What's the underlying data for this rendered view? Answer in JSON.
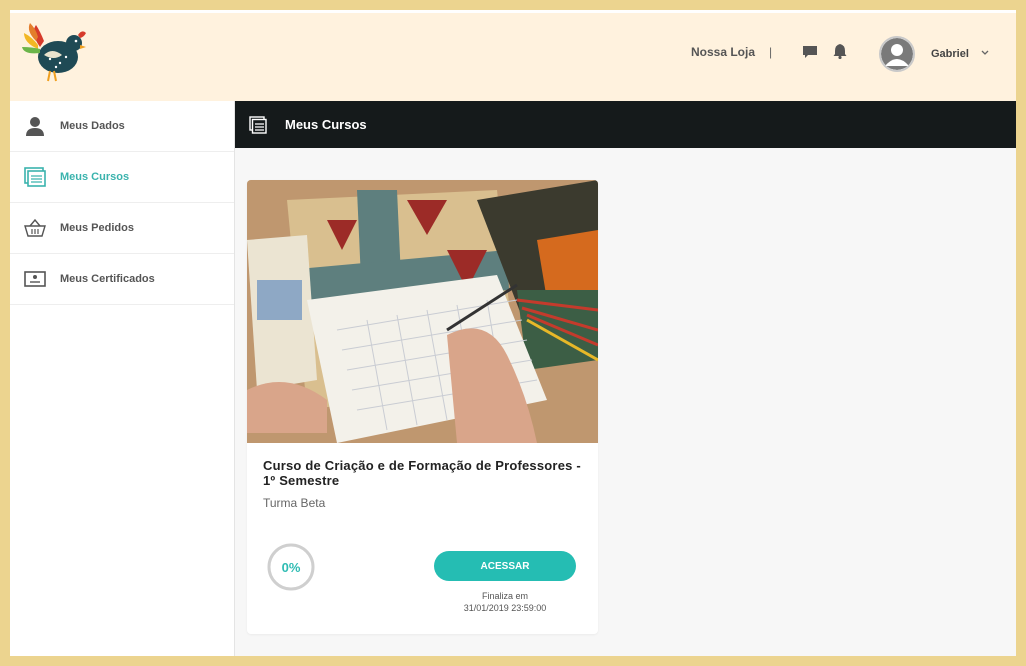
{
  "header": {
    "store_link": "Nossa Loja",
    "separator": "|",
    "user_name": "Gabriel"
  },
  "sidebar": {
    "items": [
      {
        "label": "Meus Dados",
        "icon": "user-icon"
      },
      {
        "label": "Meus Cursos",
        "icon": "courses-icon",
        "active": true
      },
      {
        "label": "Meus Pedidos",
        "icon": "basket-icon"
      },
      {
        "label": "Meus Certificados",
        "icon": "certificate-icon"
      }
    ]
  },
  "section": {
    "title": "Meus Cursos"
  },
  "course": {
    "title": "Curso de Criação e de Formação de Professores - 1º Semestre",
    "class_name": "Turma Beta",
    "progress_label": "0%",
    "progress": 0,
    "button_label": "ACESSAR",
    "ends_label": "Finaliza em",
    "ends_date": "31/01/2019 23:59:00"
  },
  "colors": {
    "accent": "#25bdb3",
    "header_bg": "#fff2de",
    "border_frame": "#ecd48f",
    "section_bar": "#151a1b"
  }
}
